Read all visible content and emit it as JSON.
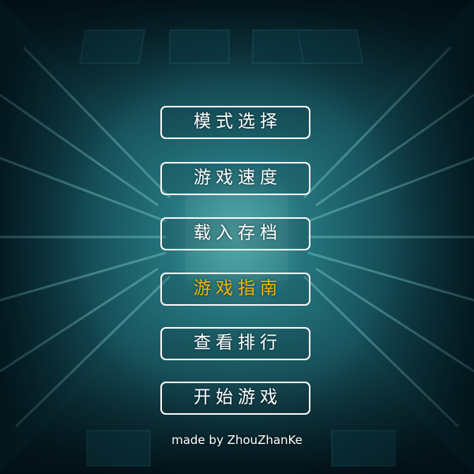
{
  "menu": {
    "items": [
      {
        "label": "模式选择",
        "selected": false
      },
      {
        "label": "游戏速度",
        "selected": false
      },
      {
        "label": "载入存档",
        "selected": false
      },
      {
        "label": "游戏指南",
        "selected": true
      },
      {
        "label": "查看排行",
        "selected": false
      },
      {
        "label": "开始游戏",
        "selected": false
      }
    ]
  },
  "credits": "made by ZhouZhanKe",
  "colors": {
    "selected_text": "#f2b705",
    "default_text": "#ffffff",
    "button_border": "#f4f6f6",
    "background_dark": "#0b2a33",
    "background_glow": "#78d2cd"
  }
}
